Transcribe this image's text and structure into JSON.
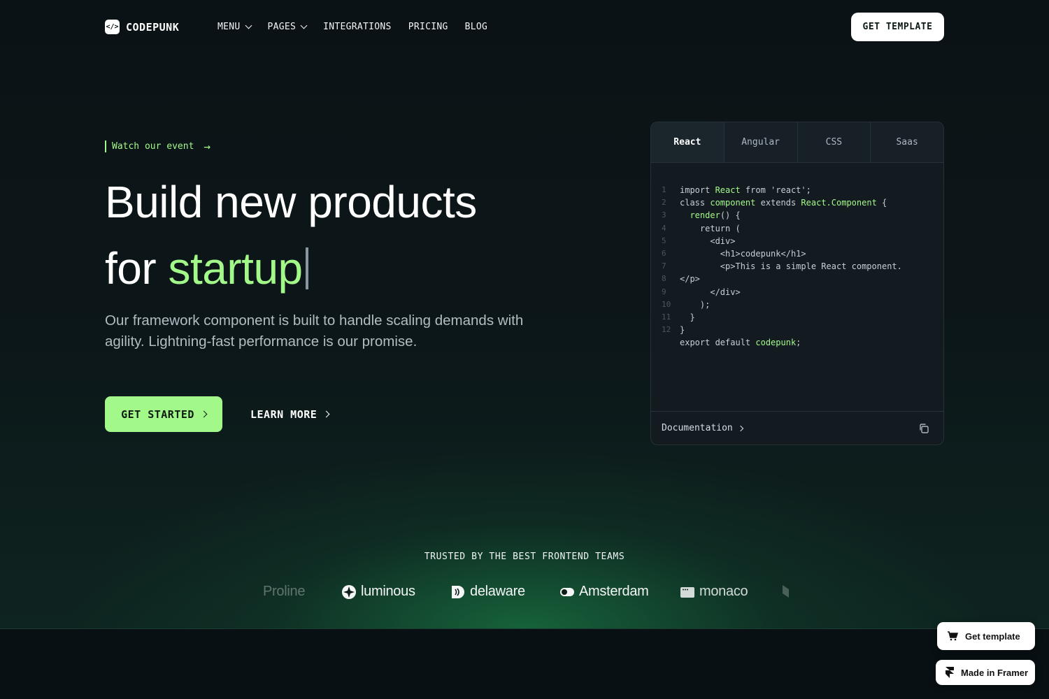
{
  "nav": {
    "logo_mark": "</>",
    "logo_text": "CODEPUNK",
    "links": [
      {
        "label": "MENU",
        "dropdown": true
      },
      {
        "label": "PAGES",
        "dropdown": true
      },
      {
        "label": "INTEGRATIONS",
        "dropdown": false
      },
      {
        "label": "PRICING",
        "dropdown": false
      },
      {
        "label": "BLOG",
        "dropdown": false
      }
    ],
    "cta_label": "GET TEMPLATE"
  },
  "hero": {
    "event_label": "Watch our event",
    "title_line1": "Build new products",
    "title_line2_prefix": "for ",
    "title_line2_accent": "startup",
    "subtitle": "Our framework component is built to handle scaling demands with agility. Lightning-fast performance is our promise.",
    "primary_button": "GET STARTED",
    "secondary_button": "LEARN MORE"
  },
  "code_card": {
    "tabs": [
      "React",
      "Angular",
      "CSS",
      "Saas"
    ],
    "active_tab": "React",
    "lines": [
      {
        "num": "1",
        "parts": [
          {
            "t": "import ",
            "hl": false
          },
          {
            "t": "React",
            "hl": true
          },
          {
            "t": " from 'react';",
            "hl": false
          }
        ]
      },
      {
        "num": "2",
        "parts": [
          {
            "t": "class ",
            "hl": false
          },
          {
            "t": "component",
            "hl": true
          },
          {
            "t": " extends ",
            "hl": false
          },
          {
            "t": "React.Component",
            "hl": true
          },
          {
            "t": " {",
            "hl": false
          }
        ]
      },
      {
        "num": "3",
        "parts": [
          {
            "t": "  ",
            "hl": false
          },
          {
            "t": "render",
            "hl": true
          },
          {
            "t": "() {",
            "hl": false
          }
        ]
      },
      {
        "num": "4",
        "parts": [
          {
            "t": "    return (",
            "hl": false
          }
        ]
      },
      {
        "num": "5",
        "parts": [
          {
            "t": "      <div>",
            "hl": false
          }
        ]
      },
      {
        "num": "6",
        "parts": [
          {
            "t": "        <h1>codepunk</h1>",
            "hl": false
          }
        ]
      },
      {
        "num": "7",
        "parts": [
          {
            "t": "        <p>This is a simple React component.",
            "hl": false
          }
        ]
      },
      {
        "num": "8",
        "parts": [
          {
            "t": "</p>",
            "hl": false
          }
        ]
      },
      {
        "num": "9",
        "parts": [
          {
            "t": "      </div>",
            "hl": false
          }
        ]
      },
      {
        "num": "10",
        "parts": [
          {
            "t": "    );",
            "hl": false
          }
        ]
      },
      {
        "num": "11",
        "parts": [
          {
            "t": "  }",
            "hl": false
          }
        ]
      },
      {
        "num": "12",
        "parts": [
          {
            "t": "}",
            "hl": false
          }
        ]
      },
      {
        "num": "",
        "parts": [
          {
            "t": "export default ",
            "hl": false
          },
          {
            "t": "codepunk",
            "hl": true
          },
          {
            "t": ";",
            "hl": false
          }
        ]
      }
    ],
    "footer_link": "Documentation"
  },
  "trusted": {
    "heading": "TRUSTED BY THE BEST FRONTEND TEAMS",
    "brands": [
      {
        "name": "Proline",
        "icon": "none"
      },
      {
        "name": "luminous",
        "icon": "flower-icon"
      },
      {
        "name": "delaware",
        "icon": "d-wave-icon"
      },
      {
        "name": "Amsterdam",
        "icon": "toggle-icon"
      },
      {
        "name": "monaco",
        "icon": "window-icon"
      }
    ]
  },
  "badges": {
    "get_template": "Get template",
    "made_in_framer": "Made in Framer"
  },
  "colors": {
    "accent": "#a3f88a",
    "background": "#0a1114",
    "glow": "#1d9650"
  }
}
